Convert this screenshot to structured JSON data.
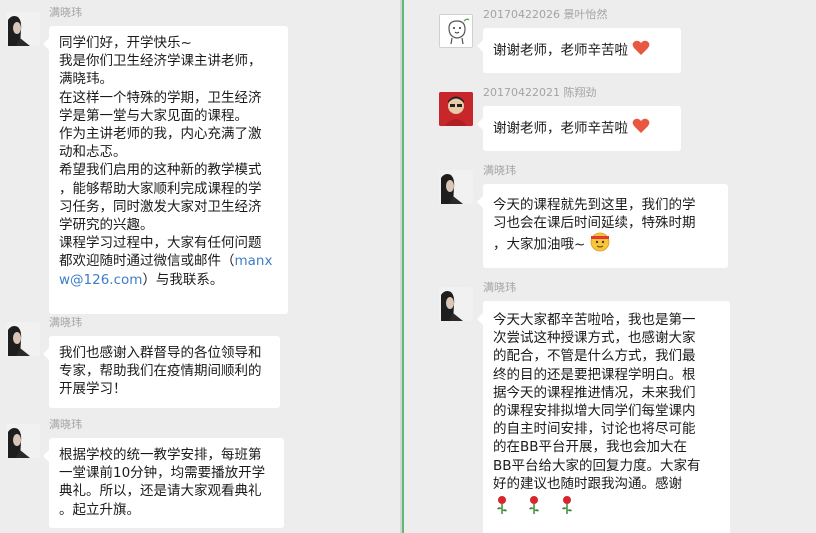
{
  "left_messages": [
    {
      "sender": "满晓玮",
      "lines": [
        "同学们好，开学快乐~",
        "我是你们卫生经济学课主讲老师，",
        "满晓玮。",
        "在这样一个特殊的学期，卫生经济",
        "学是第一堂与大家见面的课程。",
        "作为主讲老师的我，内心充满了激",
        "动和忐忑。",
        "希望我们启用的这种新的教学模式",
        "，能够帮助大家顺利完成课程的学",
        "习任务，同时激发大家对卫生经济",
        "学研究的兴趣。",
        "课程学习过程中，大家有任何问题",
        "都欢迎随时通过微信或邮件（"
      ],
      "link_part1": "manx",
      "link_part2": "w@126.com",
      "after_link": "）与我联系。"
    },
    {
      "sender": "满晓玮",
      "lines": [
        "我们也感谢入群督导的各位领导和",
        "专家，帮助我们在疫情期间顺利的",
        "开展学习！"
      ]
    },
    {
      "sender": "满晓玮",
      "lines": [
        "根据学校的统一教学安排，每班第",
        "一堂课前10分钟，均需要播放开学",
        "典礼。所以，还是请大家观看典礼",
        "。起立升旗。"
      ]
    }
  ],
  "right_messages": [
    {
      "sender": "20170422026 景叶怡然",
      "lines": [
        "谢谢老师，老师辛苦啦"
      ],
      "emoji": "heart-emoji"
    },
    {
      "sender": "20170422021 陈翔劲",
      "lines": [
        "谢谢老师，老师辛苦啦"
      ],
      "emoji": "heart-emoji"
    },
    {
      "sender": "满晓玮",
      "lines": [
        "今天的课程就先到这里，我们的学",
        "习也会在课后时间延续，特殊时期",
        "，大家加油哦~"
      ],
      "emoji": "fighting-face-emoji"
    },
    {
      "sender": "满晓玮",
      "lines": [
        "今天大家都辛苦啦哈，我也是第一",
        "次尝试这种授课方式，也感谢大家",
        "的配合，不管是什么方式，我们最",
        "终的目的还是要把课程学明白。根",
        "据今天的课程推进情况，未来我们",
        "的课程安排拟增大同学们每堂课内",
        "的自主时间安排，讨论也将尽可能",
        "的在BB平台开展，我也会加大在",
        "BB平台给大家的回复力度。大家有",
        "好的建议也随时跟我沟通。感谢"
      ],
      "emoji": "rose-emoji"
    }
  ],
  "colors": {
    "background": "#ededed",
    "bubble": "#ffffff",
    "link": "#3d7ec7",
    "divider_accent": "#5fb878",
    "meta_text": "#a4a4a4"
  }
}
